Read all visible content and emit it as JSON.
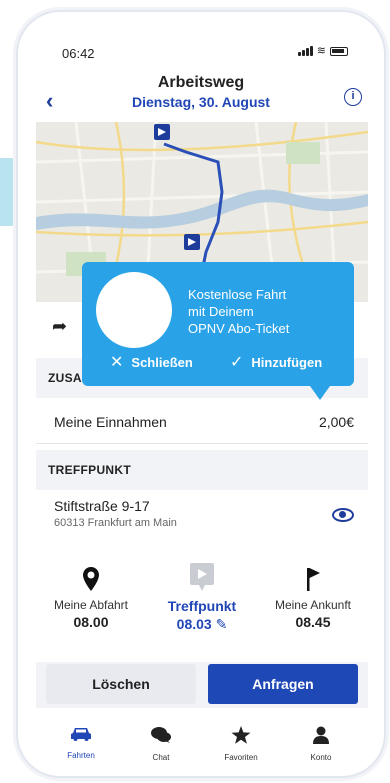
{
  "status": {
    "time": "06:42"
  },
  "header": {
    "title": "Arbeitsweg",
    "date": "Dienstag, 30. August"
  },
  "sections": {
    "extras_heading": "ZUSA",
    "meeting_heading": "TREFFPUNKT"
  },
  "earnings": {
    "label": "Meine Einnahmen",
    "value": "2,00€"
  },
  "meeting_point": {
    "street": "Stiftstraße 9-17",
    "city": "60313 Frankfurt am Main"
  },
  "stops": {
    "departure": {
      "label": "Meine Abfahrt",
      "time": "08.00"
    },
    "meeting": {
      "label": "Treffpunkt",
      "time": "08.03"
    },
    "arrival": {
      "label": "Meine Ankunft",
      "time": "08.45"
    }
  },
  "actions": {
    "delete": "Löschen",
    "request": "Anfragen"
  },
  "popup": {
    "line1": "Kostenlose Fahrt",
    "line2": "mit Deinem",
    "line3": "OPNV Abo-Ticket",
    "close": "Schließen",
    "add": "Hinzufügen"
  },
  "tabs": [
    {
      "label": "Fahrten",
      "icon": "car-icon"
    },
    {
      "label": "Chat",
      "icon": "chat-icon"
    },
    {
      "label": "Favoriten",
      "icon": "star-icon"
    },
    {
      "label": "Konto",
      "icon": "person-icon"
    }
  ],
  "colors": {
    "primary": "#1f48b7",
    "popup": "#2aa2e8",
    "route": "#2a4fb8",
    "river": "#b7cde0"
  }
}
